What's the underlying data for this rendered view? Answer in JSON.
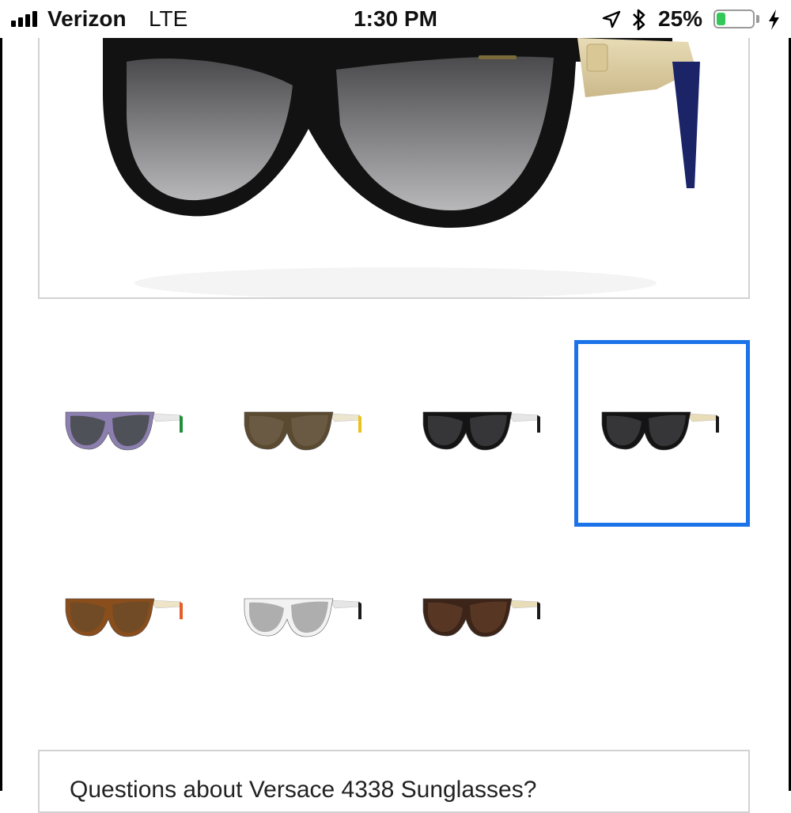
{
  "status_bar": {
    "carrier": "Verizon",
    "network": "LTE",
    "time": "1:30 PM",
    "battery_percent": "25%",
    "battery_level": 0.25,
    "icons": [
      "signal-bars-icon",
      "location-arrow-icon",
      "bluetooth-icon",
      "battery-icon",
      "charging-bolt-icon"
    ]
  },
  "product": {
    "hero_variant": "black-gold",
    "selected_variant_index": 3,
    "variants": [
      {
        "name": "purple-green",
        "lens": "#4a4d50",
        "frame": "#8c7fb0",
        "temple": "#e8e8e8",
        "tip": "#1f8f3a"
      },
      {
        "name": "brown-yellow",
        "lens": "#6b5a45",
        "frame": "#5a4a30",
        "temple": "#ece6cf",
        "tip": "#e8c21d"
      },
      {
        "name": "black-silver",
        "lens": "#3a3a3c",
        "frame": "#141414",
        "temple": "#e6e6e6",
        "tip": "#1a1a1a"
      },
      {
        "name": "black-gold",
        "lens": "#3a3a3c",
        "frame": "#141414",
        "temple": "#e9ddb8",
        "tip": "#1a1a1a"
      },
      {
        "name": "tortoise-orange",
        "lens": "#6e4b27",
        "frame": "#8a4d1c",
        "temple": "#efe4c8",
        "tip": "#e45d2a"
      },
      {
        "name": "white-mirror",
        "lens": "#a8a8a8",
        "frame": "#f2f2f2",
        "temple": "#e6e6e6",
        "tip": "#1a1a1a"
      },
      {
        "name": "havana-gold",
        "lens": "#5a3a26",
        "frame": "#3c2418",
        "temple": "#e9ddb8",
        "tip": "#1a1a1a"
      }
    ]
  },
  "questions": {
    "title": "Questions about Versace 4338 Sunglasses?"
  },
  "colors": {
    "selection_border": "#1a73e8",
    "card_border": "#d2d2d2"
  }
}
